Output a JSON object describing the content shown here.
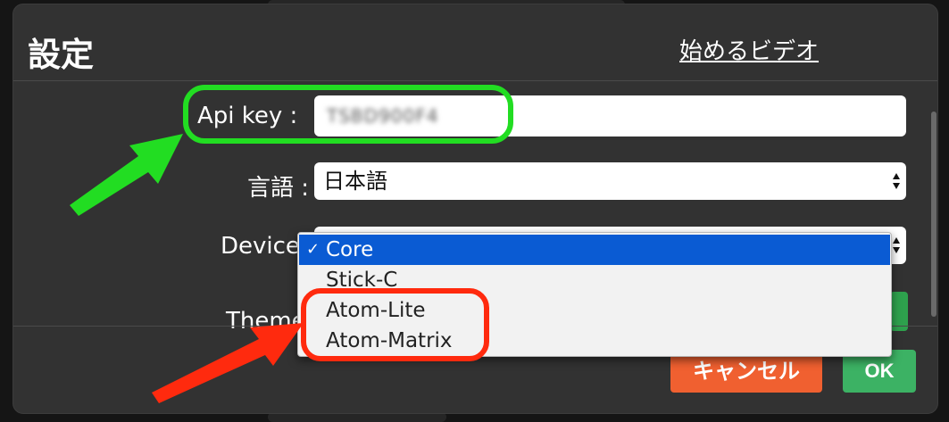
{
  "dialog": {
    "title": "設定",
    "video_link": "始めるビデオ"
  },
  "form": {
    "api_key": {
      "label": "Api key :",
      "value": "TSBD900F4"
    },
    "language": {
      "label": "言語 :",
      "selected": "日本語"
    },
    "device": {
      "label": "Device",
      "selected": "Core",
      "options": [
        "Core",
        "Stick-C",
        "Atom-Lite",
        "Atom-Matrix"
      ],
      "selected_check": "✓"
    },
    "theme": {
      "label": "Theme"
    }
  },
  "buttons": {
    "cancel": "キャンセル",
    "ok": "OK"
  },
  "colors": {
    "dialog_bg": "#323232",
    "cancel_bg": "#f06030",
    "ok_bg": "#3cb264",
    "selected_option_bg": "#0a5bd3",
    "annotation_green": "#22dd22",
    "annotation_red": "#ff2a0e"
  },
  "icons": {
    "select_arrows": "updown-arrows-icon",
    "checkmark": "checkmark-icon",
    "annotation_arrow_green": "green-arrow-icon",
    "annotation_arrow_red": "red-arrow-icon"
  }
}
